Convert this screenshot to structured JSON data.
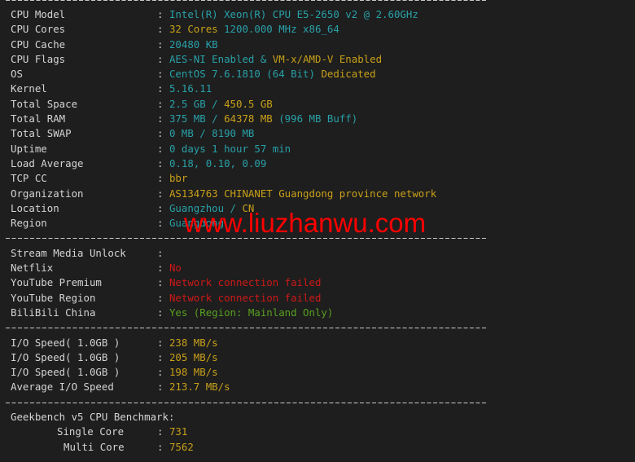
{
  "system_info": {
    "rows": [
      {
        "label": "CPU Model",
        "parts": [
          {
            "text": "Intel(R) Xeon(R) CPU E5-2650 v2 @ 2.60GHz",
            "color": "cyan"
          }
        ]
      },
      {
        "label": "CPU Cores",
        "parts": [
          {
            "text": "32 Cores",
            "color": "yellow"
          },
          {
            "text": " 1200.000 MHz x86_64",
            "color": "cyan"
          }
        ]
      },
      {
        "label": "CPU Cache",
        "parts": [
          {
            "text": "20480 KB",
            "color": "cyan"
          }
        ]
      },
      {
        "label": "CPU Flags",
        "parts": [
          {
            "text": "AES-NI Enabled & ",
            "color": "cyan"
          },
          {
            "text": "VM-x/AMD-V Enabled",
            "color": "yellow"
          }
        ]
      },
      {
        "label": "OS",
        "parts": [
          {
            "text": "CentOS 7.6.1810 (64 Bit) ",
            "color": "cyan"
          },
          {
            "text": "Dedicated",
            "color": "yellow"
          }
        ]
      },
      {
        "label": "Kernel",
        "parts": [
          {
            "text": "5.16.11",
            "color": "cyan"
          }
        ]
      },
      {
        "label": "Total Space",
        "parts": [
          {
            "text": "2.5 GB / ",
            "color": "cyan"
          },
          {
            "text": "450.5 GB",
            "color": "yellow"
          }
        ]
      },
      {
        "label": "Total RAM",
        "parts": [
          {
            "text": "375 MB / ",
            "color": "cyan"
          },
          {
            "text": "64378 MB",
            "color": "yellow"
          },
          {
            "text": " (996 MB Buff)",
            "color": "cyan"
          }
        ]
      },
      {
        "label": "Total SWAP",
        "parts": [
          {
            "text": "0 MB / 8190 MB",
            "color": "cyan"
          }
        ]
      },
      {
        "label": "Uptime",
        "parts": [
          {
            "text": "0 days 1 hour 57 min",
            "color": "cyan"
          }
        ]
      },
      {
        "label": "Load Average",
        "parts": [
          {
            "text": "0.18, 0.10, 0.09",
            "color": "cyan"
          }
        ]
      },
      {
        "label": "TCP CC",
        "parts": [
          {
            "text": "bbr",
            "color": "yellow"
          }
        ]
      },
      {
        "label": "Organization",
        "parts": [
          {
            "text": "AS134763 CHINANET Guangdong province network",
            "color": "yellow"
          }
        ]
      },
      {
        "label": "Location",
        "parts": [
          {
            "text": "Guangzhou / ",
            "color": "cyan"
          },
          {
            "text": "CN",
            "color": "yellow"
          }
        ]
      },
      {
        "label": "Region",
        "parts": [
          {
            "text": "Guangdong",
            "color": "cyan"
          }
        ]
      }
    ]
  },
  "stream_media": {
    "header": "Stream Media Unlock",
    "rows": [
      {
        "label": "Netflix",
        "parts": [
          {
            "text": "No",
            "color": "red"
          }
        ]
      },
      {
        "label": "YouTube Premium",
        "parts": [
          {
            "text": "Network connection failed",
            "color": "red"
          }
        ]
      },
      {
        "label": "YouTube Region",
        "parts": [
          {
            "text": "Network connection failed",
            "color": "red"
          }
        ]
      },
      {
        "label": "BiliBili China",
        "parts": [
          {
            "text": "Yes (Region: Mainland Only)",
            "color": "green"
          }
        ]
      }
    ]
  },
  "io_speed": {
    "rows": [
      {
        "label": "I/O Speed( 1.0GB )",
        "parts": [
          {
            "text": "238 MB/s",
            "color": "yellow"
          }
        ]
      },
      {
        "label": "I/O Speed( 1.0GB )",
        "parts": [
          {
            "text": "205 MB/s",
            "color": "yellow"
          }
        ]
      },
      {
        "label": "I/O Speed( 1.0GB )",
        "parts": [
          {
            "text": "198 MB/s",
            "color": "yellow"
          }
        ]
      },
      {
        "label": "Average I/O Speed",
        "parts": [
          {
            "text": "213.7 MB/s",
            "color": "yellow"
          }
        ]
      }
    ]
  },
  "geekbench": {
    "header": "Geekbench v5 CPU Benchmark:",
    "single_label": "Single Core",
    "single_value": "731",
    "multi_label": "Multi Core",
    "multi_value": "7562"
  },
  "separator_char": ":",
  "watermark": "www.liuzhanwu.com",
  "colors": {
    "background": "#1e1e1e",
    "cyan": "#29a0a8",
    "yellow": "#c8a018",
    "red": "#d01818",
    "green": "#58a020",
    "watermark": "#ff0000"
  }
}
